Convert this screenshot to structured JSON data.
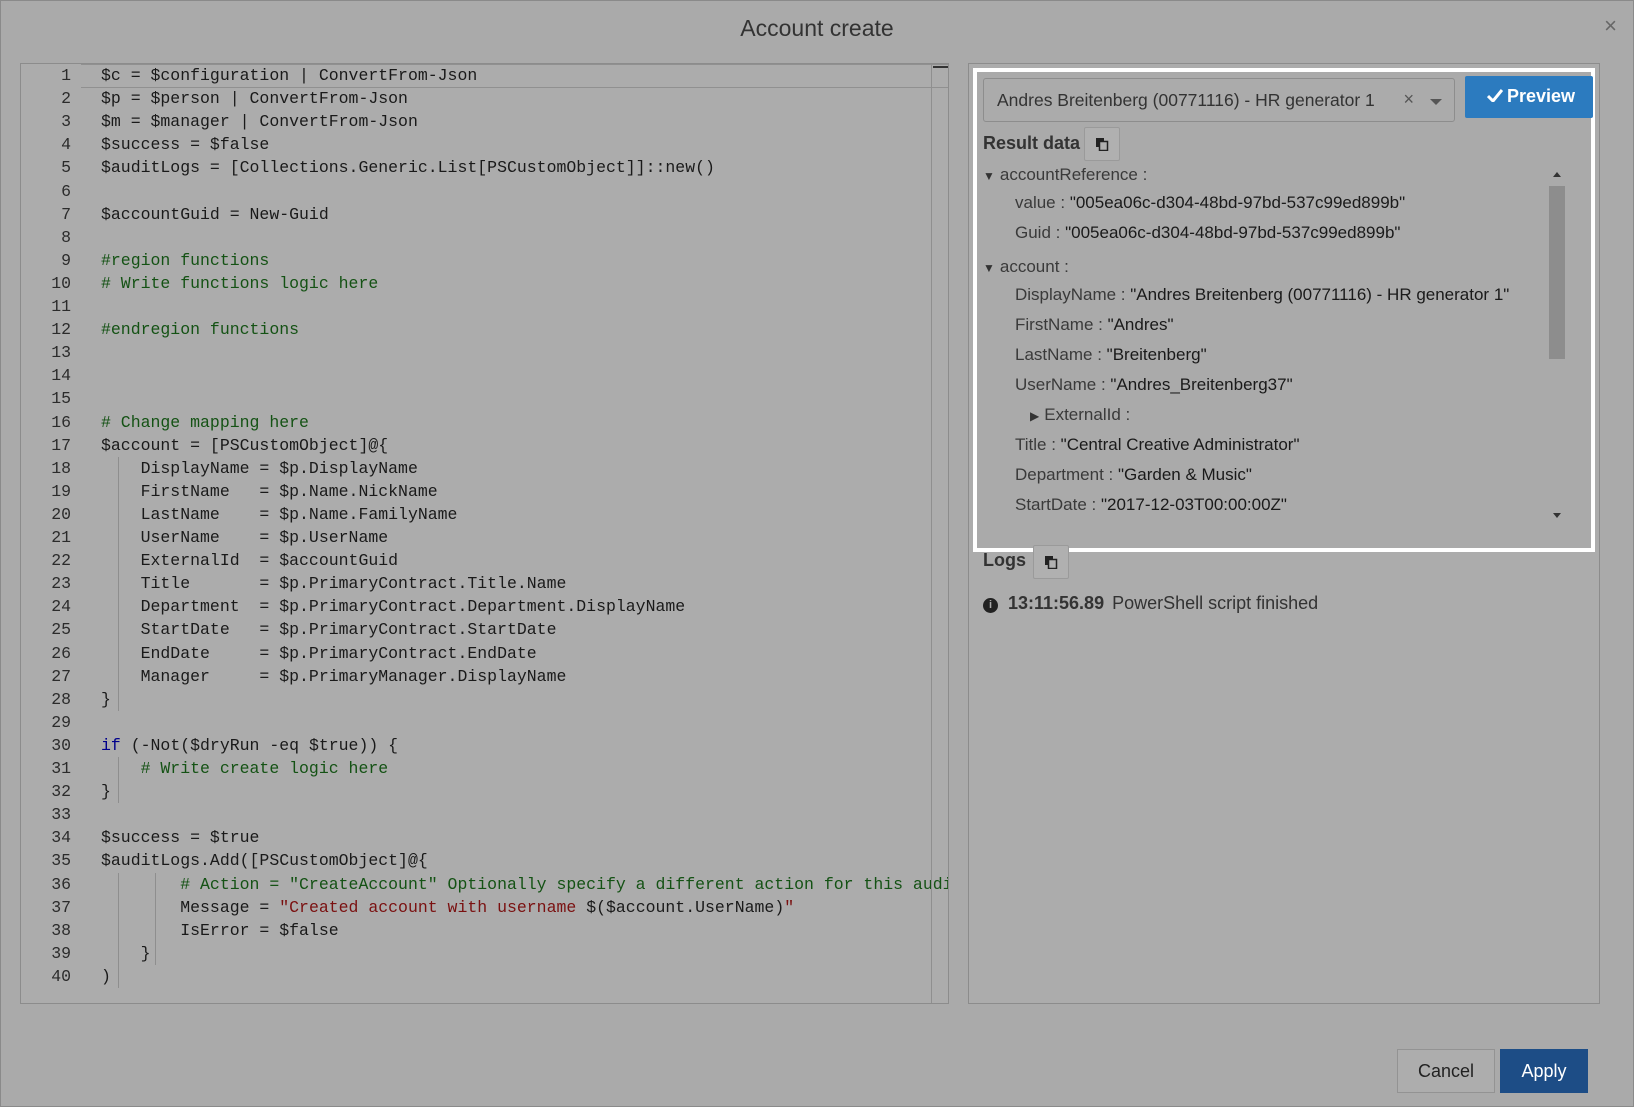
{
  "dialog": {
    "title": "Account create",
    "close_label": "×"
  },
  "editor": {
    "lines": [
      {
        "n": "1",
        "segs": [
          [
            "var",
            "$c = $configuration | ConvertFrom-Json"
          ]
        ]
      },
      {
        "n": "2",
        "segs": [
          [
            "var",
            "$p = $person | ConvertFrom-Json"
          ]
        ]
      },
      {
        "n": "3",
        "segs": [
          [
            "var",
            "$m = $manager | ConvertFrom-Json"
          ]
        ]
      },
      {
        "n": "4",
        "segs": [
          [
            "var",
            "$success = $false"
          ]
        ]
      },
      {
        "n": "5",
        "segs": [
          [
            "var",
            "$auditLogs = [Collections.Generic.List[PSCustomObject]]::new()"
          ]
        ]
      },
      {
        "n": "6",
        "segs": []
      },
      {
        "n": "7",
        "segs": [
          [
            "var",
            "$accountGuid = New-Guid"
          ]
        ]
      },
      {
        "n": "8",
        "segs": []
      },
      {
        "n": "9",
        "segs": [
          [
            "com",
            "#region functions"
          ]
        ]
      },
      {
        "n": "10",
        "segs": [
          [
            "com",
            "# Write functions logic here"
          ]
        ]
      },
      {
        "n": "11",
        "segs": []
      },
      {
        "n": "12",
        "segs": [
          [
            "com",
            "#endregion functions"
          ]
        ]
      },
      {
        "n": "13",
        "segs": []
      },
      {
        "n": "14",
        "segs": []
      },
      {
        "n": "15",
        "segs": []
      },
      {
        "n": "16",
        "segs": [
          [
            "com",
            "# Change mapping here"
          ]
        ]
      },
      {
        "n": "17",
        "segs": [
          [
            "var",
            "$account = [PSCustomObject]@{"
          ]
        ]
      },
      {
        "n": "18",
        "segs": [
          [
            "var",
            "    DisplayName = $p.DisplayName"
          ]
        ]
      },
      {
        "n": "19",
        "segs": [
          [
            "var",
            "    FirstName   = $p.Name.NickName"
          ]
        ]
      },
      {
        "n": "20",
        "segs": [
          [
            "var",
            "    LastName    = $p.Name.FamilyName"
          ]
        ]
      },
      {
        "n": "21",
        "segs": [
          [
            "var",
            "    UserName    = $p.UserName"
          ]
        ]
      },
      {
        "n": "22",
        "segs": [
          [
            "var",
            "    ExternalId  = $accountGuid"
          ]
        ]
      },
      {
        "n": "23",
        "segs": [
          [
            "var",
            "    Title       = $p.PrimaryContract.Title.Name"
          ]
        ]
      },
      {
        "n": "24",
        "segs": [
          [
            "var",
            "    Department  = $p.PrimaryContract.Department.DisplayName"
          ]
        ]
      },
      {
        "n": "25",
        "segs": [
          [
            "var",
            "    StartDate   = $p.PrimaryContract.StartDate"
          ]
        ]
      },
      {
        "n": "26",
        "segs": [
          [
            "var",
            "    EndDate     = $p.PrimaryContract.EndDate"
          ]
        ]
      },
      {
        "n": "27",
        "segs": [
          [
            "var",
            "    Manager     = $p.PrimaryManager.DisplayName"
          ]
        ]
      },
      {
        "n": "28",
        "segs": [
          [
            "var",
            "}"
          ]
        ]
      },
      {
        "n": "29",
        "segs": []
      },
      {
        "n": "30",
        "segs": [
          [
            "kw",
            "if"
          ],
          [
            "var",
            " (-Not($dryRun -eq $true)) {"
          ]
        ]
      },
      {
        "n": "31",
        "segs": [
          [
            "com",
            "    # Write create logic here"
          ]
        ]
      },
      {
        "n": "32",
        "segs": [
          [
            "var",
            "}"
          ]
        ]
      },
      {
        "n": "33",
        "segs": []
      },
      {
        "n": "34",
        "segs": [
          [
            "var",
            "$success = $true"
          ]
        ]
      },
      {
        "n": "35",
        "segs": [
          [
            "var",
            "$auditLogs.Add([PSCustomObject]@{"
          ]
        ]
      },
      {
        "n": "36",
        "segs": [
          [
            "com",
            "        # Action = \"CreateAccount\" Optionally specify a different action for this audit"
          ]
        ]
      },
      {
        "n": "37",
        "segs": [
          [
            "var",
            "        Message = "
          ],
          [
            "str",
            "\"Created account with username "
          ],
          [
            "var",
            "$($account.UserName)"
          ],
          [
            "str",
            "\""
          ]
        ]
      },
      {
        "n": "38",
        "segs": [
          [
            "var",
            "        IsError = $false"
          ]
        ]
      },
      {
        "n": "39",
        "segs": [
          [
            "var",
            "    }"
          ]
        ]
      },
      {
        "n": "40",
        "segs": [
          [
            "var",
            ")"
          ]
        ]
      }
    ]
  },
  "preview": {
    "selected_person": "Andres Breitenberg (00771116) - HR generator 1",
    "clear_label": "×",
    "button_label": "Preview"
  },
  "result": {
    "label": "Result data",
    "tree": [
      {
        "indent": 0,
        "toggle": "▼",
        "key": "accountReference :",
        "value": ""
      },
      {
        "indent": 2,
        "toggle": "",
        "key": "value : ",
        "value": "\"005ea06c-d304-48bd-97bd-537c99ed899b\""
      },
      {
        "indent": 2,
        "toggle": "",
        "key": "Guid : ",
        "value": "\"005ea06c-d304-48bd-97bd-537c99ed899b\""
      },
      {
        "indent": 0,
        "toggle": "▼",
        "key": "account :",
        "value": ""
      },
      {
        "indent": 2,
        "toggle": "",
        "key": "DisplayName : ",
        "value": "\"Andres Breitenberg (00771116) - HR generator 1\""
      },
      {
        "indent": 2,
        "toggle": "",
        "key": "FirstName : ",
        "value": "\"Andres\""
      },
      {
        "indent": 2,
        "toggle": "",
        "key": "LastName : ",
        "value": "\"Breitenberg\""
      },
      {
        "indent": 2,
        "toggle": "",
        "key": "UserName : ",
        "value": "\"Andres_Breitenberg37\""
      },
      {
        "indent": 1,
        "toggle": "▶",
        "key": "ExternalId :",
        "value": ""
      },
      {
        "indent": 2,
        "toggle": "",
        "key": "Title : ",
        "value": "\"Central Creative Administrator\""
      },
      {
        "indent": 2,
        "toggle": "",
        "key": "Department : ",
        "value": "\"Garden & Music\""
      },
      {
        "indent": 2,
        "toggle": "",
        "key": "StartDate : ",
        "value": "\"2017-12-03T00:00:00Z\""
      }
    ]
  },
  "logs": {
    "label": "Logs",
    "entries": [
      {
        "icon": "info-icon",
        "time": "13:11:56.89",
        "message": "PowerShell script finished"
      }
    ]
  },
  "footer": {
    "cancel_label": "Cancel",
    "apply_label": "Apply"
  },
  "colors": {
    "preview_button": "#2c7bbf",
    "apply_button": "#1d4d86",
    "overlay": "#aaaaaa"
  }
}
